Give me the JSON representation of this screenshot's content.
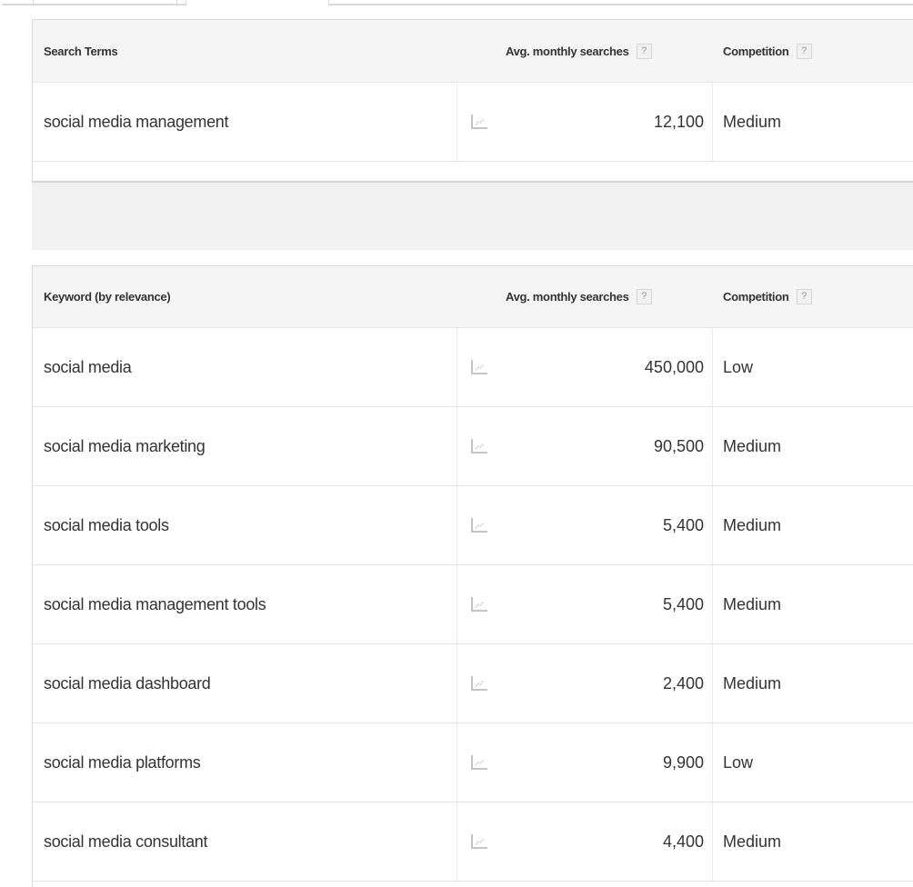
{
  "search_terms_table": {
    "headers": {
      "term": "Search Terms",
      "avg_monthly_searches": "Avg. monthly searches",
      "competition": "Competition",
      "help_glyph": "?"
    },
    "rows": [
      {
        "term": "social media management",
        "trend_icon": "line-chart-icon",
        "avg_monthly_searches": "12,100",
        "competition": "Medium"
      }
    ]
  },
  "keyword_table": {
    "headers": {
      "term": "Keyword (by relevance)",
      "avg_monthly_searches": "Avg. monthly searches",
      "competition": "Competition",
      "help_glyph": "?"
    },
    "rows": [
      {
        "term": "social media",
        "trend_icon": "line-chart-icon",
        "avg_monthly_searches": "450,000",
        "competition": "Low"
      },
      {
        "term": "social media marketing",
        "trend_icon": "line-chart-icon",
        "avg_monthly_searches": "90,500",
        "competition": "Medium"
      },
      {
        "term": "social media tools",
        "trend_icon": "line-chart-icon",
        "avg_monthly_searches": "5,400",
        "competition": "Medium"
      },
      {
        "term": "social media management tools",
        "trend_icon": "line-chart-icon",
        "avg_monthly_searches": "5,400",
        "competition": "Medium"
      },
      {
        "term": "social media dashboard",
        "trend_icon": "line-chart-icon",
        "avg_monthly_searches": "2,400",
        "competition": "Medium"
      },
      {
        "term": "social media platforms",
        "trend_icon": "line-chart-icon",
        "avg_monthly_searches": "9,900",
        "competition": "Low"
      },
      {
        "term": "social media consultant",
        "trend_icon": "line-chart-icon",
        "avg_monthly_searches": "4,400",
        "competition": "Medium"
      }
    ]
  },
  "colors": {
    "header_bg": "#f5f5f5",
    "band_bg": "#f1f1f1",
    "border": "#d9d9d9",
    "text": "#333333",
    "icon": "#bbbbbb"
  }
}
